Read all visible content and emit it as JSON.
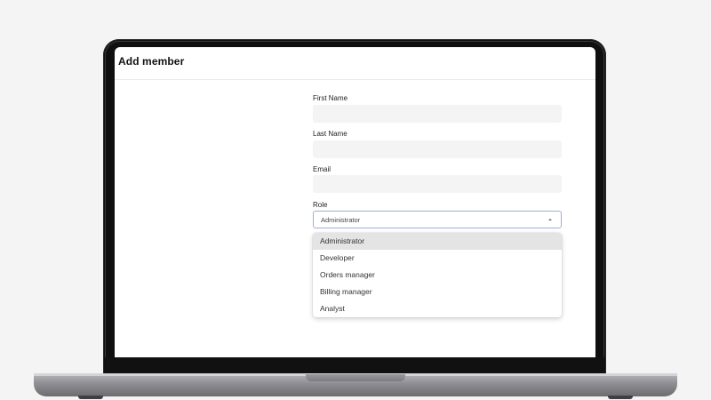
{
  "app": {
    "title": "Add member"
  },
  "form": {
    "first_name": {
      "label": "First Name",
      "value": ""
    },
    "last_name": {
      "label": "Last Name",
      "value": ""
    },
    "email": {
      "label": "Email",
      "value": ""
    },
    "role": {
      "label": "Role",
      "selected": "Administrator",
      "icon": "chevron-up-icon",
      "options": [
        "Administrator",
        "Developer",
        "Orders manager",
        "Billing manager",
        "Analyst"
      ]
    }
  },
  "colors": {
    "selected_option_bg": "#e4e4e4",
    "input_bg": "#f4f4f4",
    "focus_border": "#9ab0d8"
  }
}
